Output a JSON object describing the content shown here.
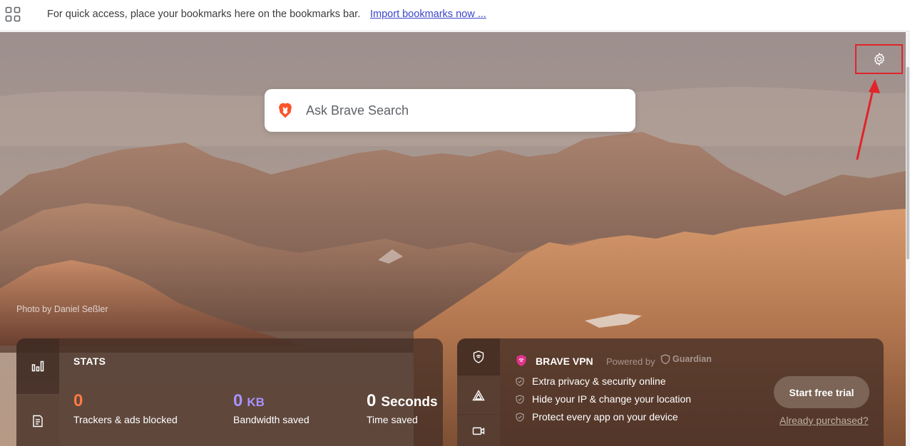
{
  "bookmarks_bar": {
    "apps_icon": "apps-grid-icon",
    "message": "For quick access, place your bookmarks here on the bookmarks bar.",
    "import_link": "Import bookmarks now ..."
  },
  "background": {
    "photo_credit": "Photo by Daniel Seßler"
  },
  "settings": {
    "icon": "gear-icon",
    "highlight_color": "#e0242a"
  },
  "search": {
    "placeholder": "Ask Brave Search",
    "logo": "brave-lion-icon"
  },
  "stats": {
    "title": "STATS",
    "tabs": [
      {
        "icon": "bar-chart-icon"
      },
      {
        "icon": "news-icon"
      }
    ],
    "items": [
      {
        "value": "0",
        "unit": "",
        "label": "Trackers & ads blocked",
        "color": "#ff7a45"
      },
      {
        "value": "0",
        "unit": "KB",
        "label": "Bandwidth saved",
        "color": "#a893ff"
      },
      {
        "value": "0",
        "unit": "Seconds",
        "label": "Time saved",
        "color": "#ffffff"
      }
    ]
  },
  "vpn": {
    "title": "BRAVE VPN",
    "powered_by": "Powered by",
    "partner": "Guardian",
    "tabs": [
      {
        "icon": "vpn-shield-icon"
      },
      {
        "icon": "triangle-icon"
      },
      {
        "icon": "video-camera-icon"
      }
    ],
    "features": [
      "Extra privacy & security online",
      "Hide your IP & change your location",
      "Protect every app on your device"
    ],
    "trial_button": "Start free trial",
    "purchased_link": "Already purchased?",
    "accent_color": "#e0338a"
  }
}
